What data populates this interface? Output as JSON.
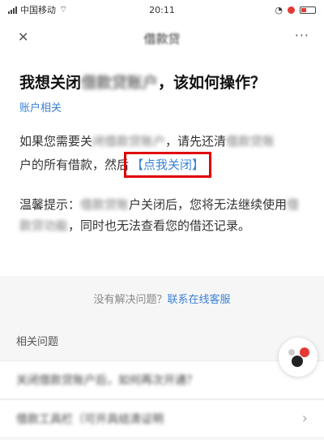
{
  "status_bar": {
    "carrier": "中国移动",
    "time": "20:11",
    "battery": ""
  },
  "nav": {
    "close_glyph": "✕",
    "title": "借款贷",
    "more_glyph": "···"
  },
  "question": {
    "prefix": "我想关闭",
    "blurred": "借款贷账户",
    "suffix": "，该如何操作？"
  },
  "category": "账户相关",
  "answer": {
    "p1_start": "如果您需要关",
    "p1_blur1": "闭借款贷账户",
    "p1_mid": "，请先还清",
    "p1_blur2": "借款贷账",
    "p1_line2": "户的所有借款，然后",
    "p1_link": "【点我关闭】",
    "p2_start": "温馨提示：",
    "p2_blur1": "借款贷账",
    "p2_mid": "户关闭后，您将无法继续使用",
    "p2_blur2": "借款贷功能",
    "p2_end": "，同时也无法查看您的借还记录。"
  },
  "help": {
    "text": "没有解决问题？",
    "link": "联系在线客服"
  },
  "related": {
    "title": "相关问题",
    "items": [
      {
        "label": "关闭借款贷账户后，如何再次开通？"
      },
      {
        "label": "借款工具栏（可开具结清证明"
      }
    ]
  },
  "float_button": {
    "icon": "chat-bubble-icon"
  }
}
